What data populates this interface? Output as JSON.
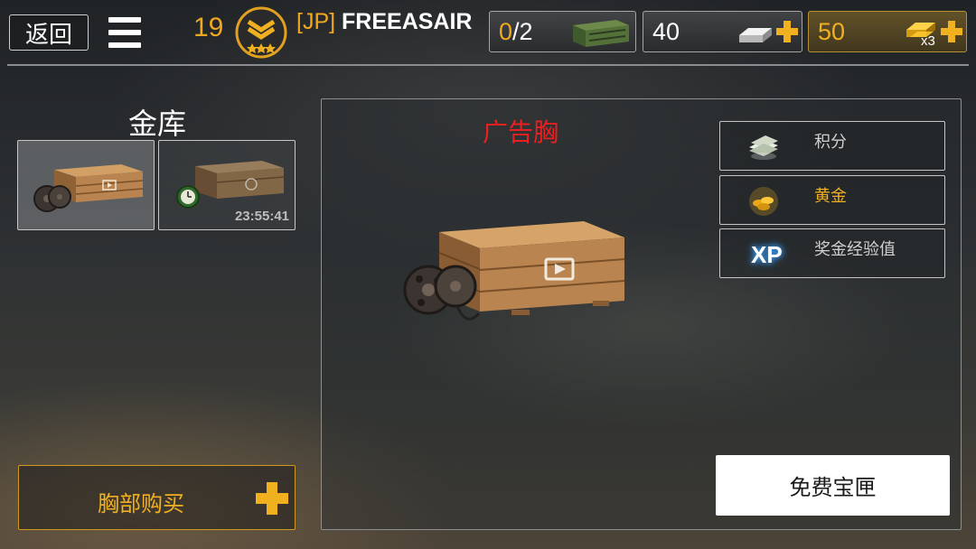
{
  "header": {
    "back_label": "返回",
    "level": "19",
    "clan_tag": "[JP]",
    "player_name": "FREEASAIR",
    "chests_current": "0",
    "chests_max": "/2",
    "silver": "40",
    "gold": "50",
    "gold_multiplier": "x3"
  },
  "vault": {
    "title": "金库",
    "slots": [
      {
        "name": "ad-chest"
      },
      {
        "name": "timed-chest",
        "timer": "23:55:41"
      }
    ],
    "buy_label": "胸部购买"
  },
  "detail": {
    "chest_name": "广告胸",
    "rewards": [
      {
        "icon": "cash-icon",
        "label": "积分"
      },
      {
        "icon": "gold-coins-icon",
        "label": "黄金"
      },
      {
        "icon": "xp-icon",
        "label": "奖金经验值",
        "icon_text": "XP"
      }
    ],
    "open_button": "免费宝匣"
  },
  "colors": {
    "accent": "#f0a820",
    "chest_name": "#e82020",
    "panel_border": "#8d9092"
  }
}
